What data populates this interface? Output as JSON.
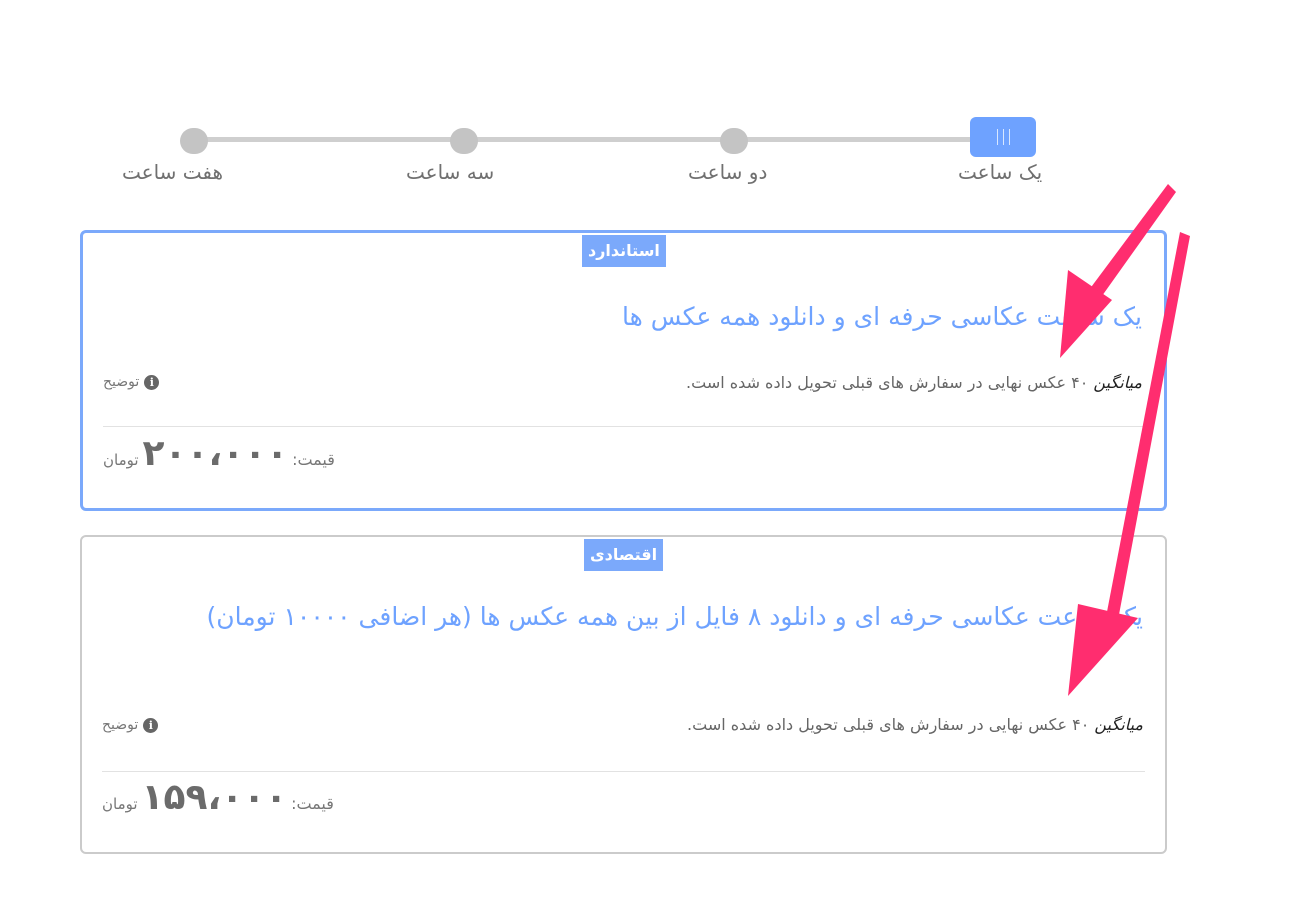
{
  "slider": {
    "steps": [
      {
        "label": "یک ساعت"
      },
      {
        "label": "دو ساعت"
      },
      {
        "label": "سه ساعت"
      },
      {
        "label": "هفت ساعت"
      }
    ],
    "selected_label": "یک ساعت"
  },
  "plans": [
    {
      "badge": "استاندارد",
      "title": "یک ساعت عکاسی حرفه ای و دانلود همه عکس ها",
      "desc_prefix": "میانگین",
      "desc_rest": "۴۰ عکس نهایی در سفارش های قبلی تحویل داده شده است.",
      "info_label": "توضیح",
      "price_label": "قیمت:",
      "price_value": "۲۰۰،۰۰۰",
      "currency": "تومان",
      "selected": true
    },
    {
      "badge": "اقتصادی",
      "title": "یک ساعت عکاسی حرفه ای و دانلود ۸ فایل از بین همه عکس ها (هر اضافی ۱۰۰۰۰ تومان)",
      "desc_prefix": "میانگین",
      "desc_rest": "۴۰ عکس نهایی در سفارش های قبلی تحویل داده شده است.",
      "info_label": "توضیح",
      "price_label": "قیمت:",
      "price_value": "۱۵۹،۰۰۰",
      "currency": "تومان",
      "selected": false
    }
  ],
  "colors": {
    "accent": "#6ea2ff",
    "badge": "#7ba9fb",
    "annotation_arrow": "#ff2d6f"
  },
  "icons": {
    "info": "info-circle-icon",
    "slider_handle": "grip-lines-icon",
    "annotation": "arrow-icon"
  }
}
